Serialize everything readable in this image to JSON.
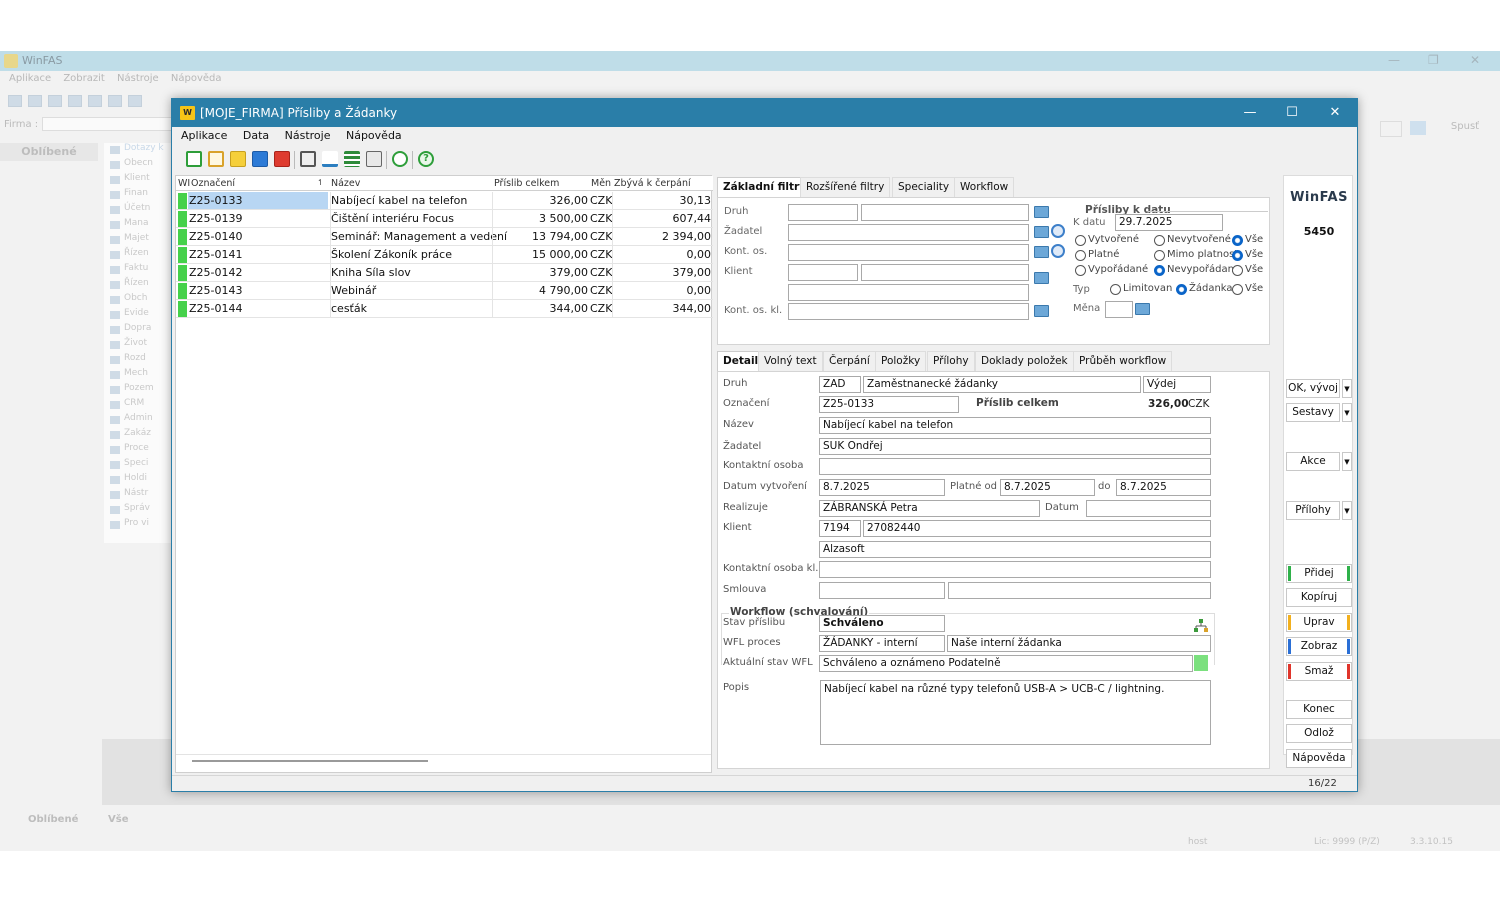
{
  "background_app": {
    "title": "WinFAS",
    "menu": [
      "Aplikace",
      "Zobrazit",
      "Nástroje",
      "Nápověda"
    ],
    "firma_label": "Firma :",
    "run_label": "Spusť",
    "favorites_header": "Oblíbené",
    "tree": [
      "Obecn",
      "Klient",
      "Finan",
      "Účetn",
      "Mana",
      "Majet",
      "Řízen",
      "Faktu",
      "Řízen",
      "Obch",
      "Evide",
      "Dopra",
      "Život",
      "Rozd",
      "Mech",
      "Pozem",
      "CRM",
      "Admin",
      "Zakáz",
      "Proce",
      "Speci",
      "Holdi",
      "Nástr",
      "Správ",
      "Pro vi"
    ],
    "tree_selected": "Dotazy k",
    "bottom_tabs": [
      "Oblíbené",
      "Vše"
    ],
    "status_user": "host",
    "status_lic": "Lic: 9999  (P/Z)",
    "status_version": "3.3.10.15"
  },
  "dialog": {
    "logo_text": "W",
    "title": "[MOJE_FIRMA] Přísliby a Žádanky",
    "menu": [
      "Aplikace",
      "Data",
      "Nástroje",
      "Nápověda"
    ],
    "window_controls": [
      "minimize-icon",
      "maximize-icon",
      "close-icon"
    ]
  },
  "list": {
    "headers": {
      "wi": "WI",
      "oznaceni": "Označení",
      "nazev": "Název",
      "celkem": "Příslib celkem",
      "mena": "Měn",
      "zbyva": "Zbývá k čerpání"
    },
    "rows": [
      {
        "oznaceni": "Z25-0133",
        "nazev": "Nabíjecí kabel na telefon",
        "celkem": "326,00",
        "mena": "CZK",
        "zbyva": "30,13",
        "selected": true
      },
      {
        "oznaceni": "Z25-0139",
        "nazev": "Čištění interiéru Focus",
        "celkem": "3 500,00",
        "mena": "CZK",
        "zbyva": "607,44"
      },
      {
        "oznaceni": "Z25-0140",
        "nazev": "Seminář: Management a vedení",
        "celkem": "13 794,00",
        "mena": "CZK",
        "zbyva": "2 394,00"
      },
      {
        "oznaceni": "Z25-0141",
        "nazev": "Školení Zákoník práce",
        "celkem": "15 000,00",
        "mena": "CZK",
        "zbyva": "0,00"
      },
      {
        "oznaceni": "Z25-0142",
        "nazev": "Kniha Síla slov",
        "celkem": "379,00",
        "mena": "CZK",
        "zbyva": "379,00"
      },
      {
        "oznaceni": "Z25-0143",
        "nazev": "Webinář",
        "celkem": "4 790,00",
        "mena": "CZK",
        "zbyva": "0,00"
      },
      {
        "oznaceni": "Z25-0144",
        "nazev": "cesťák",
        "celkem": "344,00",
        "mena": "CZK",
        "zbyva": "344,00"
      }
    ]
  },
  "filters": {
    "tabs": [
      "Základní filtry",
      "Rozšířené filtry",
      "Speciality",
      "Workflow"
    ],
    "labels": {
      "druh": "Druh",
      "zadatel": "Žadatel",
      "kont_os": "Kont. os.",
      "klient": "Klient",
      "kont_os_kl": "Kont. os. kl."
    },
    "prisliby_title": "Přísliby k datu",
    "k_datu_label": "K datu",
    "k_datu_value": "29.7.2025",
    "radios": {
      "vytvorene": "Vytvořené",
      "nevytvorene": "Nevytvořené",
      "vse1": "Vše",
      "platne": "Platné",
      "mimo": "Mimo platnost",
      "vse2": "Vše",
      "vyporadane": "Vypořádané",
      "nevyporadan": "Nevypořádan",
      "vse3": "Vše",
      "limitovan": "Limitovan",
      "zadanka": "Žádanka",
      "vse4": "Vše"
    },
    "typ_label": "Typ",
    "mena_label": "Měna"
  },
  "detail": {
    "tabs": [
      "Detail",
      "Volný text",
      "Čerpání",
      "Položky",
      "Přílohy",
      "Doklady položek",
      "Průběh workflow"
    ],
    "labels": {
      "druh": "Druh",
      "oznaceni": "Označení",
      "nazev": "Název",
      "zadatel": "Žadatel",
      "kontaktni_osoba": "Kontaktní osoba",
      "datum_vytvoreni": "Datum vytvoření",
      "platne_od": "Platné od",
      "do": "do",
      "realizuje": "Realizuje",
      "datum": "Datum",
      "klient": "Klient",
      "kontaktni_osoba_kl": "Kontaktní osoba kl.",
      "smlouva": "Smlouva",
      "workflow_title": "Workflow (schvalování)",
      "stav_prislibu": "Stav příslibu",
      "wfl_proces": "WFL proces",
      "aktualni_stav": "Aktuální stav WFL",
      "popis": "Popis",
      "prislib_celkem": "Příslib celkem"
    },
    "values": {
      "druh_code": "ZAD",
      "druh_name": "Zaměstnanecké žádanky",
      "druh_type": "Výdej",
      "oznaceni": "Z25-0133",
      "celkem_amount": "326,00",
      "celkem_currency": "CZK",
      "nazev": "Nabíjecí kabel na telefon",
      "zadatel": "SUK Ondřej",
      "kontaktni_osoba": "",
      "datum_vytvoreni": "8.7.2025",
      "platne_od": "8.7.2025",
      "platne_do": "8.7.2025",
      "realizuje": "ZÁBRANSKÁ Petra",
      "datum": "",
      "klient_id": "7194",
      "klient_ico": "27082440",
      "klient_name": "Alzasoft",
      "kontaktni_osoba_kl": "",
      "smlouva_a": "",
      "smlouva_b": "",
      "stav_prislibu": "Schváleno",
      "wfl_proces_code": "ŽÁDANKY - interní",
      "wfl_proces_name": "Naše interní žádanka",
      "aktualni_stav": "Schváleno a oznámeno Podatelně",
      "popis": "Nabíjecí kabel na různé typy telefonů USB-A > UCB-C / lightning."
    }
  },
  "right_panel": {
    "logo": "WinFAS",
    "number": "5450",
    "buttons": {
      "ok": "OK, vývoj",
      "sestavy": "Sestavy",
      "akce": "Akce",
      "prilohy": "Přílohy",
      "pridej": "Přidej",
      "kopiruj": "Kopíruj",
      "uprav": "Uprav",
      "zobraz": "Zobraz",
      "smaz": "Smaž",
      "konec": "Konec",
      "odloz": "Odlož",
      "napoveda": "Nápověda"
    }
  },
  "status": {
    "count": "16/22"
  },
  "colors": {
    "title_bar": "#2a7ea8",
    "row_marker": "#46d14b",
    "selection": "#b8d6f3",
    "add_bar": "#2fb14a",
    "edit_bar": "#f2b01e",
    "view_bar": "#2a6fd6",
    "delete_bar": "#e0352b"
  }
}
